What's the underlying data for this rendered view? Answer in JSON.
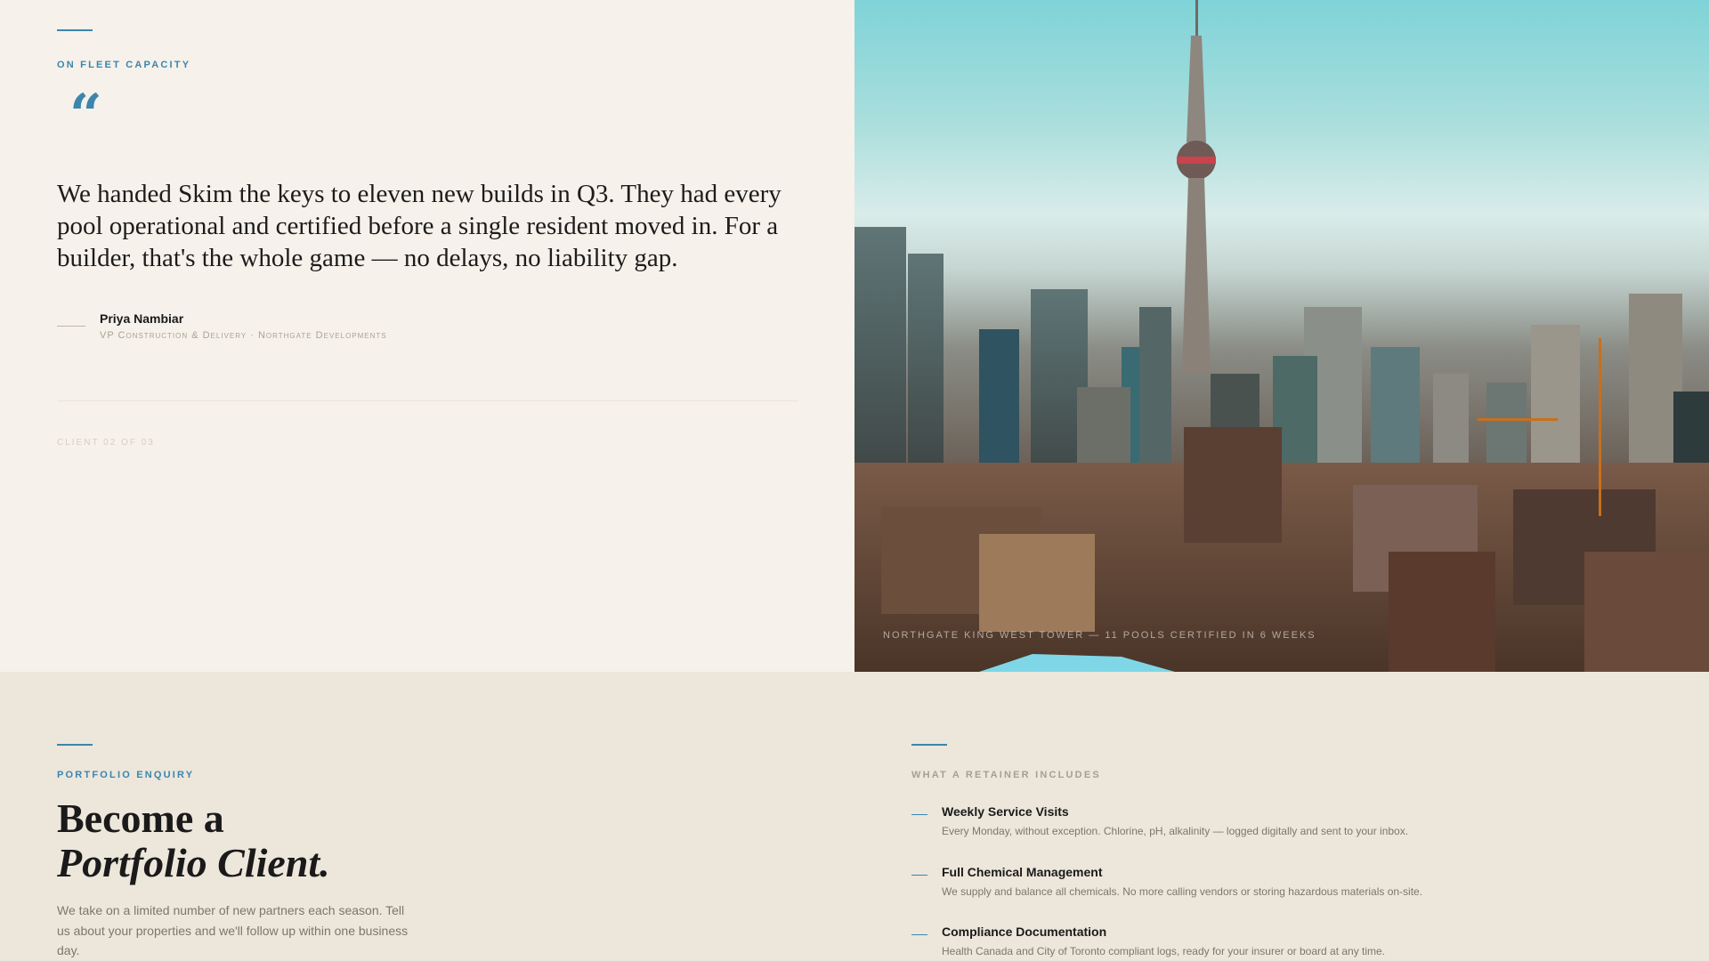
{
  "testimonial": {
    "eyebrow": "On fleet capacity",
    "quote_mark": "“",
    "quote": "We handed Skim the keys to eleven new builds in Q3. They had every pool operational and certified before a single resident moved in. For a builder, that's the whole game — no delays, no liability gap.",
    "name": "Priya Nambiar",
    "role": "VP Construction & Delivery · Northgate Developments",
    "counter": "CLIENT 02 OF 03"
  },
  "image": {
    "caption": "NORTHGATE KING WEST TOWER — 11 POOLS CERTIFIED IN 6 WEEKS"
  },
  "enquiry": {
    "eyebrow": "Portfolio enquiry",
    "title_line1": "Become a",
    "title_line2": "Portfolio Client.",
    "body": "We take on a limited number of new partners each season. Tell us about your properties and we'll follow up within one business day."
  },
  "retainer": {
    "eyebrow": "What a retainer includes",
    "items": [
      {
        "title": "Weekly Service Visits",
        "desc": "Every Monday, without exception. Chlorine, pH, alkalinity — logged digitally and sent to your inbox."
      },
      {
        "title": "Full Chemical Management",
        "desc": "We supply and balance all chemicals. No more calling vendors or storing hazardous materials on-site."
      },
      {
        "title": "Compliance Documentation",
        "desc": "Health Canada and City of Toronto compliant logs, ready for your insurer or board at any time."
      }
    ]
  },
  "colors": {
    "accent": "#3a86ae",
    "panel": "#f6f1ea",
    "section": "#ede6db"
  }
}
